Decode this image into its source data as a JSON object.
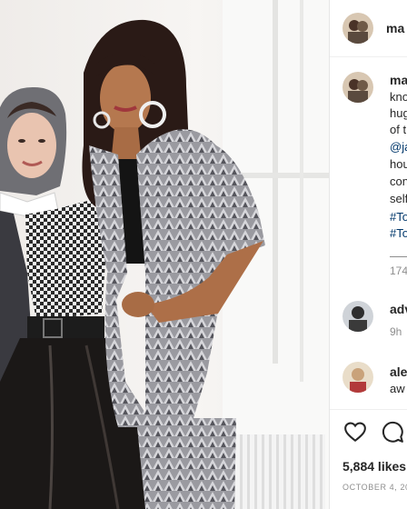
{
  "post": {
    "author": "ma",
    "photo_alt": "Two women posing together in a bright room"
  },
  "caption": {
    "username": "ma",
    "lines": [
      "kno",
      "hug",
      "of t",
      "@ja",
      "hou",
      "con",
      "self"
    ],
    "hashtags": [
      "#To",
      "#To"
    ],
    "view_replies": "174"
  },
  "comments": [
    {
      "username": "adv",
      "time": "9h"
    },
    {
      "username": "ale",
      "text": "aw"
    }
  ],
  "actions": {
    "like_icon": "heart-icon",
    "comment_icon": "comment-icon"
  },
  "likes": "5,884 likes",
  "date": "OCTOBER 4, 20"
}
